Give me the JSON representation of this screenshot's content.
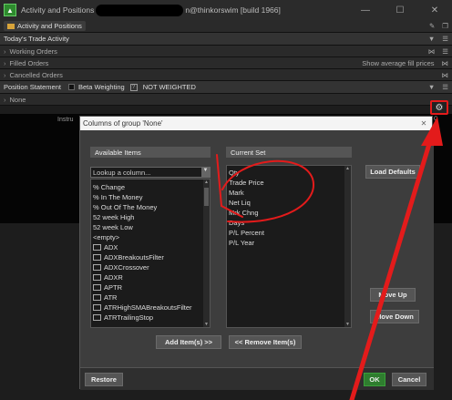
{
  "window": {
    "title_prefix": "Activity and Positions",
    "title_suffix": "n@thinkorswim [build 1966]",
    "controls": [
      "—",
      "☐",
      "✕"
    ]
  },
  "sections": {
    "tab_label": "Activity and Positions",
    "todays_trade": "Today's Trade Activity",
    "working_orders": "Working Orders",
    "filled_orders": "Filled Orders",
    "show_avg_fill": "Show average fill prices",
    "cancelled_orders": "Cancelled Orders",
    "position_statement": "Position Statement",
    "beta_weighting": "Beta Weighting",
    "not_weighted": "NOT WEIGHTED",
    "none_group": "None",
    "instru": "Instru"
  },
  "dialog": {
    "title": "Columns of group 'None'",
    "available_header": "Available Items",
    "current_header": "Current Set",
    "lookup_placeholder": "Lookup a column...",
    "available_items": [
      {
        "label": "% Change",
        "icon": false
      },
      {
        "label": "% In The Money",
        "icon": false
      },
      {
        "label": "% Out Of The Money",
        "icon": false
      },
      {
        "label": "52 week High",
        "icon": false
      },
      {
        "label": "52 week Low",
        "icon": false
      },
      {
        "label": "<empty>",
        "icon": false
      },
      {
        "label": "ADX",
        "icon": true
      },
      {
        "label": "ADXBreakoutsFilter",
        "icon": true
      },
      {
        "label": "ADXCrossover",
        "icon": true
      },
      {
        "label": "ADXR",
        "icon": true
      },
      {
        "label": "APTR",
        "icon": true
      },
      {
        "label": "ATR",
        "icon": true
      },
      {
        "label": "ATRHighSMABreakoutsFilter",
        "icon": true
      },
      {
        "label": "ATRTrailingStop",
        "icon": true
      }
    ],
    "current_items": [
      "Qty",
      "Trade Price",
      "Mark",
      "Net Liq",
      "Mrk Chng",
      "Days",
      "P/L Percent",
      "P/L Year"
    ],
    "buttons": {
      "load_defaults": "Load Defaults",
      "move_up": "Move Up",
      "move_down": "Move Down",
      "add_items": "Add Item(s) >>",
      "remove_items": "<< Remove Item(s)",
      "restore": "Restore",
      "ok": "OK",
      "cancel": "Cancel"
    }
  },
  "colors": {
    "annotation": "#e31b1b",
    "ok_green": "#2f7d2f"
  }
}
